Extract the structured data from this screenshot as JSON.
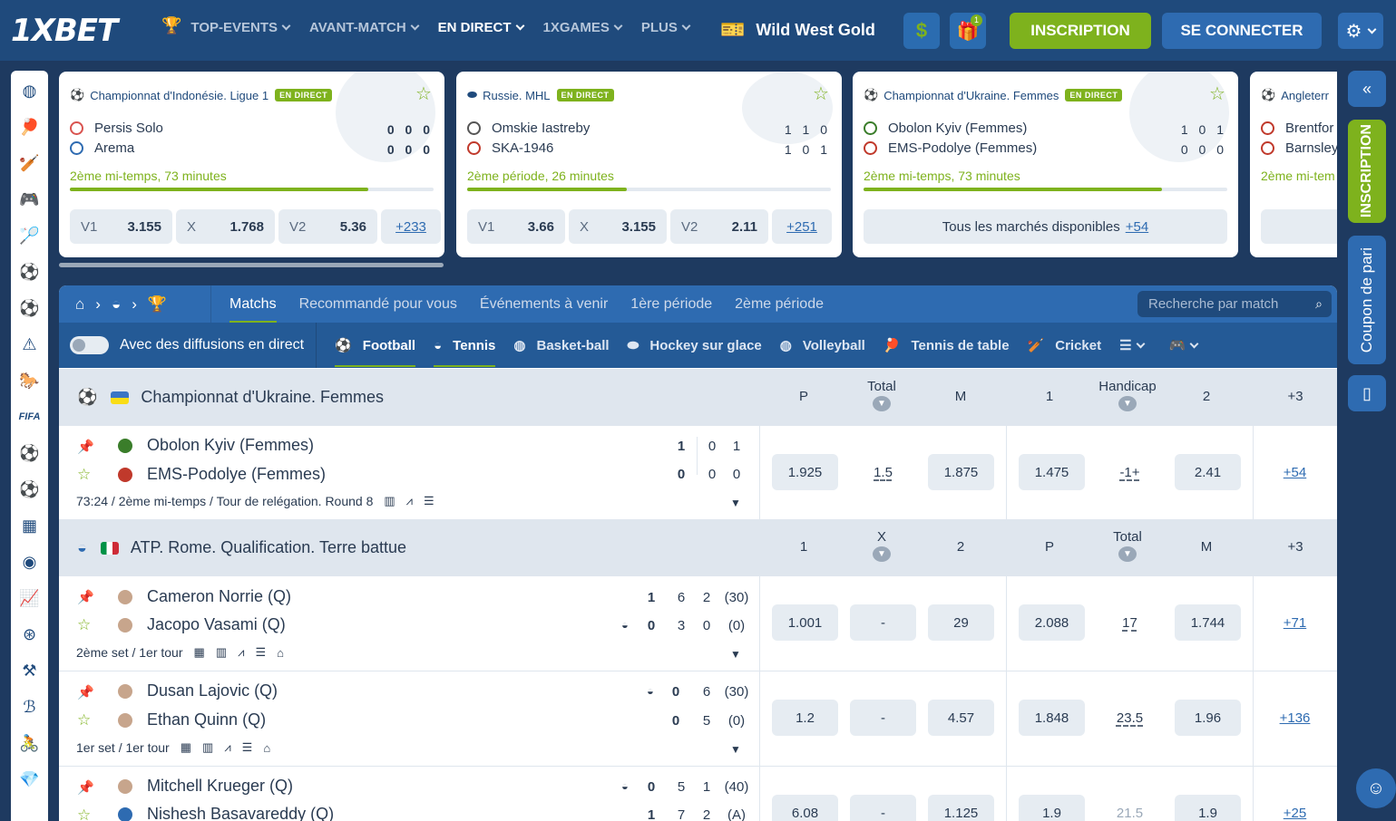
{
  "header": {
    "logo": "1XBET",
    "nav": [
      {
        "label": "TOP-EVENTS",
        "active": false
      },
      {
        "label": "AVANT-MATCH",
        "active": false
      },
      {
        "label": "EN DIRECT",
        "active": true
      },
      {
        "label": "1XGAMES",
        "active": false
      },
      {
        "label": "PLUS",
        "active": false
      }
    ],
    "promo": "Wild West Gold",
    "gift_badge": "1",
    "register_label": "INSCRIPTION",
    "login_label": "SE CONNECTER"
  },
  "live_cards": [
    {
      "league": "Championnat d'Indonésie. Ligue 1",
      "live_label": "EN DIRECT",
      "team1": "Persis Solo",
      "team2": "Arema",
      "score1": "0 0 0",
      "score2": "0 0 0",
      "period": "2ème mi-temps, 73 minutes",
      "progress": 0.82,
      "odds": [
        {
          "l": "V1",
          "v": "3.155"
        },
        {
          "l": "X",
          "v": "1.768"
        },
        {
          "l": "V2",
          "v": "5.36"
        }
      ],
      "more": "+233"
    },
    {
      "league": "Russie. MHL",
      "live_label": "EN DIRECT",
      "team1": "Omskie Iastreby",
      "team2": "SKA-1946",
      "score1": "1 1 0",
      "score2": "1 0 1",
      "period": "2ème période, 26 minutes",
      "progress": 0.44,
      "odds": [
        {
          "l": "V1",
          "v": "3.66"
        },
        {
          "l": "X",
          "v": "3.155"
        },
        {
          "l": "V2",
          "v": "2.11"
        }
      ],
      "more": "+251"
    },
    {
      "league": "Championnat d'Ukraine. Femmes",
      "live_label": "EN DIRECT",
      "team1": "Obolon Kyiv (Femmes)",
      "team2": "EMS-Podolye (Femmes)",
      "score1": "1 0 1",
      "score2": "0 0 0",
      "period": "2ème mi-temps, 73 minutes",
      "progress": 0.82,
      "all_markets": "Tous les marchés disponibles",
      "all_markets_count": "+54"
    },
    {
      "league": "Angleterr",
      "team1": "Brentfor",
      "team2": "Barnsley",
      "period": "2ème mi-tem"
    }
  ],
  "tabs": {
    "items": [
      "Matchs",
      "Recommandé pour vous",
      "Événements à venir",
      "1ère période",
      "2ème période"
    ],
    "search_placeholder": "Recherche par match"
  },
  "sportsbar": {
    "toggle_label": "Avec des diffusions en direct",
    "sports": [
      "Football",
      "Tennis",
      "Basket-ball",
      "Hockey sur glace",
      "Volleyball",
      "Tennis de table",
      "Cricket"
    ]
  },
  "leagues": [
    {
      "name": "Championnat d'Ukraine. Femmes",
      "cols": [
        "P",
        "Total",
        "M",
        "1",
        "Handicap",
        "2",
        "+3"
      ],
      "matches": [
        {
          "p1": "Obolon Kyiv (Femmes)",
          "p2": "EMS-Podolye (Femmes)",
          "s1": [
            "1",
            "0",
            "1"
          ],
          "s2": [
            "0",
            "0",
            "0"
          ],
          "info": "73:24 / 2ème mi-temps / Tour de relégation. Round 8",
          "odds": [
            "1.925",
            "1.5",
            "1.875",
            "1.475",
            "-1+",
            "2.41"
          ],
          "more": "+54"
        }
      ]
    },
    {
      "name": "ATP. Rome. Qualification. Terre battue",
      "cols": [
        "1",
        "X",
        "2",
        "P",
        "Total",
        "M",
        "+3"
      ],
      "matches": [
        {
          "p1": "Cameron Norrie (Q)",
          "p2": "Jacopo Vasami (Q)",
          "s1": [
            "1",
            "6",
            "2",
            "(30)"
          ],
          "s2": [
            "0",
            "3",
            "0",
            "(0)"
          ],
          "info": "2ème set / 1er tour",
          "odds": [
            "1.001",
            "-",
            "29",
            "2.088",
            "17",
            "1.744"
          ],
          "more": "+71"
        },
        {
          "p1": "Dusan Lajovic (Q)",
          "p2": "Ethan Quinn (Q)",
          "s1": [
            "0",
            "6",
            "(30)"
          ],
          "s2": [
            "0",
            "5",
            "(0)"
          ],
          "info": "1er set / 1er tour",
          "odds": [
            "1.2",
            "-",
            "4.57",
            "1.848",
            "23.5",
            "1.96"
          ],
          "more": "+136"
        },
        {
          "p1": "Mitchell Krueger (Q)",
          "p2": "Nishesh Basavareddy (Q)",
          "s1": [
            "0",
            "5",
            "1",
            "(40)"
          ],
          "s2": [
            "1",
            "7",
            "2",
            "(A)"
          ],
          "info": "",
          "odds": [
            "6.08",
            "-",
            "1.125",
            "1.9",
            "21.5",
            "1.9"
          ],
          "more": "+25"
        }
      ]
    }
  ],
  "rightbar": {
    "register": "INSCRIPTION",
    "coupon": "Coupon de pari"
  },
  "colors": {
    "accent": "#7eb21d",
    "primary": "#2e6bb1",
    "header": "#1f4a7c"
  }
}
